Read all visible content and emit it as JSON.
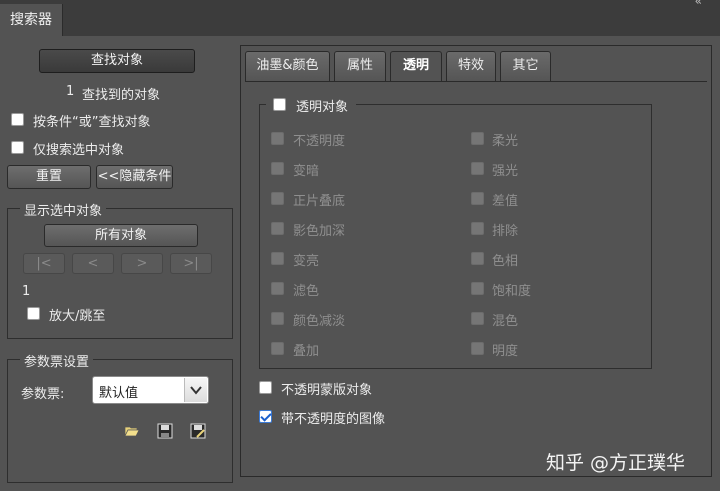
{
  "window": {
    "title": "搜索器",
    "collapse_glyph": "«"
  },
  "left": {
    "find_button": "查找对象",
    "found_count": "1",
    "found_label": "查找到的对象",
    "or_search_label": "按条件“或”查找对象",
    "search_selected_label": "仅搜索选中对象",
    "reset_button": "重置",
    "hide_conditions_button": "<<隐藏条件",
    "show_selected_group": {
      "title": "显示选中对象",
      "all_objects_button": "所有对象",
      "nav": [
        "|<",
        "<",
        ">",
        ">|"
      ],
      "index": "1",
      "zoom_label": "放大/跳至"
    },
    "param_group": {
      "title": "参数票设置",
      "label": "参数票:",
      "select_value": "默认值",
      "icons": [
        "folder-open-icon",
        "save-icon",
        "save-as-icon"
      ]
    }
  },
  "tabs": [
    "油墨&颜色",
    "属性",
    "透明",
    "特效",
    "其它"
  ],
  "active_tab": "透明",
  "transparency": {
    "group_title": "透明对象",
    "left_col": [
      "不透明度",
      "变暗",
      "正片叠底",
      "影色加深",
      "变亮",
      "滤色",
      "颜色减淡",
      "叠加"
    ],
    "right_col": [
      "柔光",
      "强光",
      "差值",
      "排除",
      "色相",
      "饱和度",
      "混色",
      "明度"
    ],
    "opacity_mask_label": "不透明蒙版对象",
    "image_with_opacity_label": "带不透明度的图像",
    "image_with_opacity_checked": true
  },
  "watermark": "知乎 @方正璞华"
}
